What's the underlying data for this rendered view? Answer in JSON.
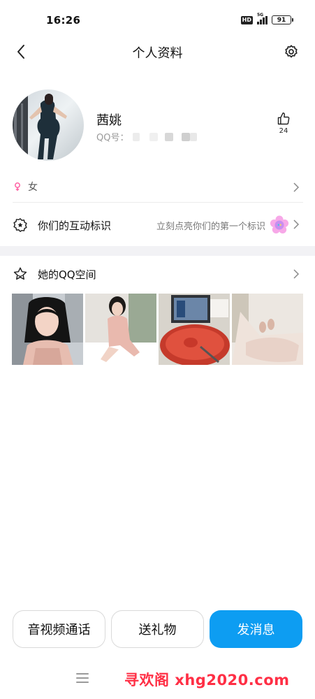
{
  "status_bar": {
    "time": "16:26",
    "hd_label": "HD",
    "network_label": "5G",
    "battery_level": "91"
  },
  "nav": {
    "title": "个人资料",
    "back_icon": "chevron-left-icon",
    "settings_icon": "gear-icon"
  },
  "profile": {
    "nickname": "茜姚",
    "qq_label": "QQ号：",
    "like_count": "24",
    "like_icon": "thumbs-up-icon",
    "gender": "女",
    "gender_icon": "female-icon"
  },
  "interaction": {
    "label": "你们的互动标识",
    "hint": "立刻点亮你们的第一个标识",
    "icon": "badge-star-icon"
  },
  "qzone": {
    "label": "她的QQ空间",
    "icon": "star-icon"
  },
  "actions": {
    "video_call": "音视频通话",
    "send_gift": "送礼物",
    "send_message": "发消息"
  },
  "colors": {
    "primary": "#0d9df2",
    "watermark": "#ff2f45",
    "section_bg": "#f2f2f5"
  },
  "watermark": "寻欢阁 xhg2020.com"
}
